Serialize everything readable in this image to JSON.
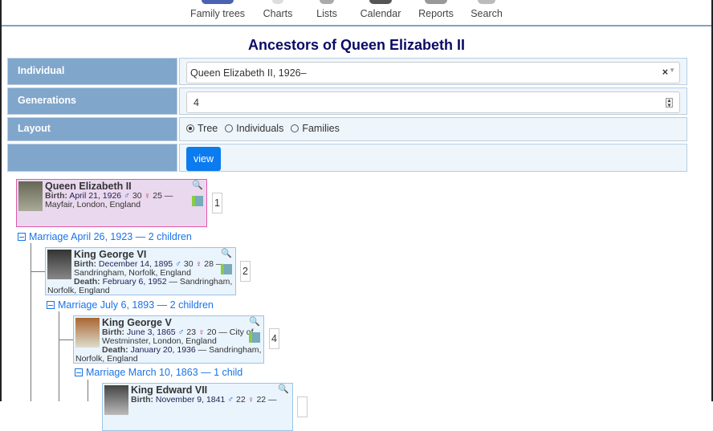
{
  "nav": [
    "Family trees",
    "Charts",
    "Lists",
    "Calendar",
    "Reports",
    "Search"
  ],
  "title": "Ancestors of Queen Elizabeth II",
  "form": {
    "individual_label": "Individual",
    "individual_value": "Queen Elizabeth II, 1926–",
    "clear": "×",
    "generations_label": "Generations",
    "generations_value": "4",
    "layout_label": "Layout",
    "layout_options": [
      "Tree",
      "Individuals",
      "Families"
    ],
    "layout_selected": "Tree",
    "view_label": "view"
  },
  "persons": [
    {
      "name": "Queen Elizabeth II",
      "birth_label": "Birth:",
      "birth_date": "April 21, 1926",
      "father_age": "30",
      "mother_age": "25",
      "birth_place": "— Mayfair, London, England",
      "number": "1"
    },
    {
      "name": "King George VI",
      "birth_label": "Birth:",
      "birth_date": "December 14, 1895",
      "father_age": "30",
      "mother_age": "28",
      "birth_place": "— Sandringham, Norfolk, England",
      "death_label": "Death:",
      "death_date": "February 6, 1952",
      "death_place": "— Sandringham, Norfolk, England",
      "number": "2"
    },
    {
      "name": "King George V",
      "birth_label": "Birth:",
      "birth_date": "June 3, 1865",
      "father_age": "23",
      "mother_age": "20",
      "birth_place": "— City of Westminster, London, England",
      "death_label": "Death:",
      "death_date": "January 20, 1936",
      "death_place": "— Sandringham, Norfolk, England",
      "number": "4"
    },
    {
      "name": "King Edward VII",
      "birth_label": "Birth:",
      "birth_date": "November 9, 1841",
      "father_age": "22",
      "mother_age": "22",
      "birth_place": "—"
    }
  ],
  "marriages": [
    "Marriage April 26, 1923 — 2 children",
    "Marriage July 6, 1893 — 2 children",
    "Marriage March 10, 1863 — 1 child"
  ]
}
